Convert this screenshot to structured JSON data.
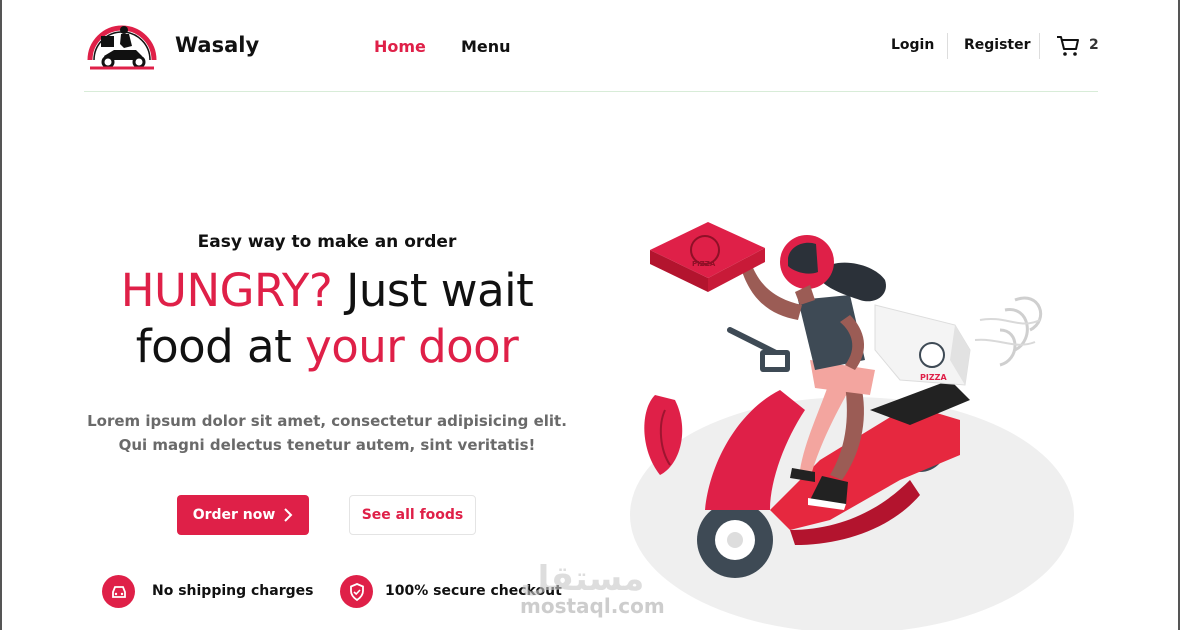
{
  "header": {
    "brand": "Wasaly",
    "logo_icon": "delivery-scooter-logo",
    "nav": {
      "home": "Home",
      "menu": "Menu"
    },
    "auth": {
      "login": "Login",
      "register": "Register"
    },
    "cart": {
      "icon": "cart-icon",
      "count": "2"
    }
  },
  "hero": {
    "tagline": "Easy way to make an order",
    "title_red_1": "HUNGRY?",
    "title_black_1": " Just wait",
    "title_black_2": "food at ",
    "title_red_2": "your door",
    "desc_line1": "Lorem ipsum dolor sit amet, consectetur adipisicing elit.",
    "desc_line2": "Qui magni delectus tenetur autem, sint veritatis!",
    "order_button": "Order now",
    "foods_button": "See all foods"
  },
  "features": [
    {
      "label": "No shipping charges",
      "icon": "car-icon"
    },
    {
      "label": "100% secure checkout",
      "icon": "shield-icon"
    }
  ],
  "illustration": {
    "box_text": "PIZZA"
  },
  "watermark": {
    "arabic": "مستقل",
    "latin": "mostaql.com"
  },
  "colors": {
    "accent": "#df2048",
    "text": "#111111",
    "muted": "#6a6a6a"
  }
}
